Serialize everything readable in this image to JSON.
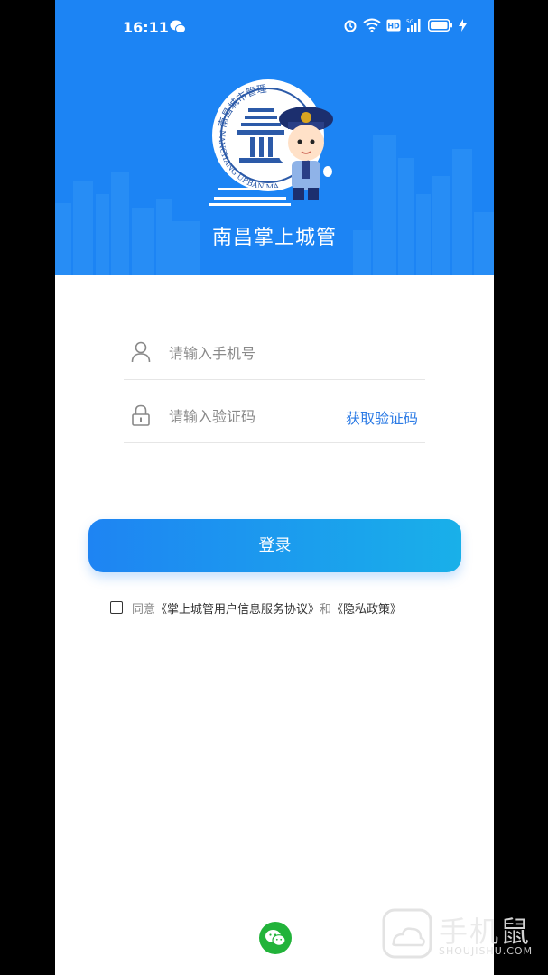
{
  "status_bar": {
    "time": "16:11",
    "icons": [
      "wechat-icon",
      "alarm-icon",
      "wifi-icon",
      "hd-icon",
      "signal-5g-icon",
      "battery-icon",
      "charging-icon"
    ]
  },
  "header": {
    "logo_ring_text": "南昌城市管理",
    "logo_bottom_text": "NANCHANG URBAN MA",
    "title": "南昌掌上城管",
    "background_color": "#1c84f4"
  },
  "form": {
    "phone_placeholder": "请输入手机号",
    "phone_icon": "user-icon",
    "code_placeholder": "请输入验证码",
    "code_icon": "lock-icon",
    "get_code_label": "获取验证码"
  },
  "login_button": {
    "label": "登录"
  },
  "agreement": {
    "prefix": "同意",
    "service_link": "《掌上城管用户信息服务协议》",
    "and": "和",
    "privacy_link": "《隐私政策》",
    "checked": false
  },
  "third_party": {
    "icon": "wechat-login-icon"
  },
  "watermark": {
    "text": "手机鼠",
    "sub": "SHOUJISHU.COM"
  },
  "colors": {
    "accent": "#2c7be5",
    "button_start": "#1e84f3",
    "button_end": "#19b0e9",
    "wechat": "#22b33a"
  }
}
